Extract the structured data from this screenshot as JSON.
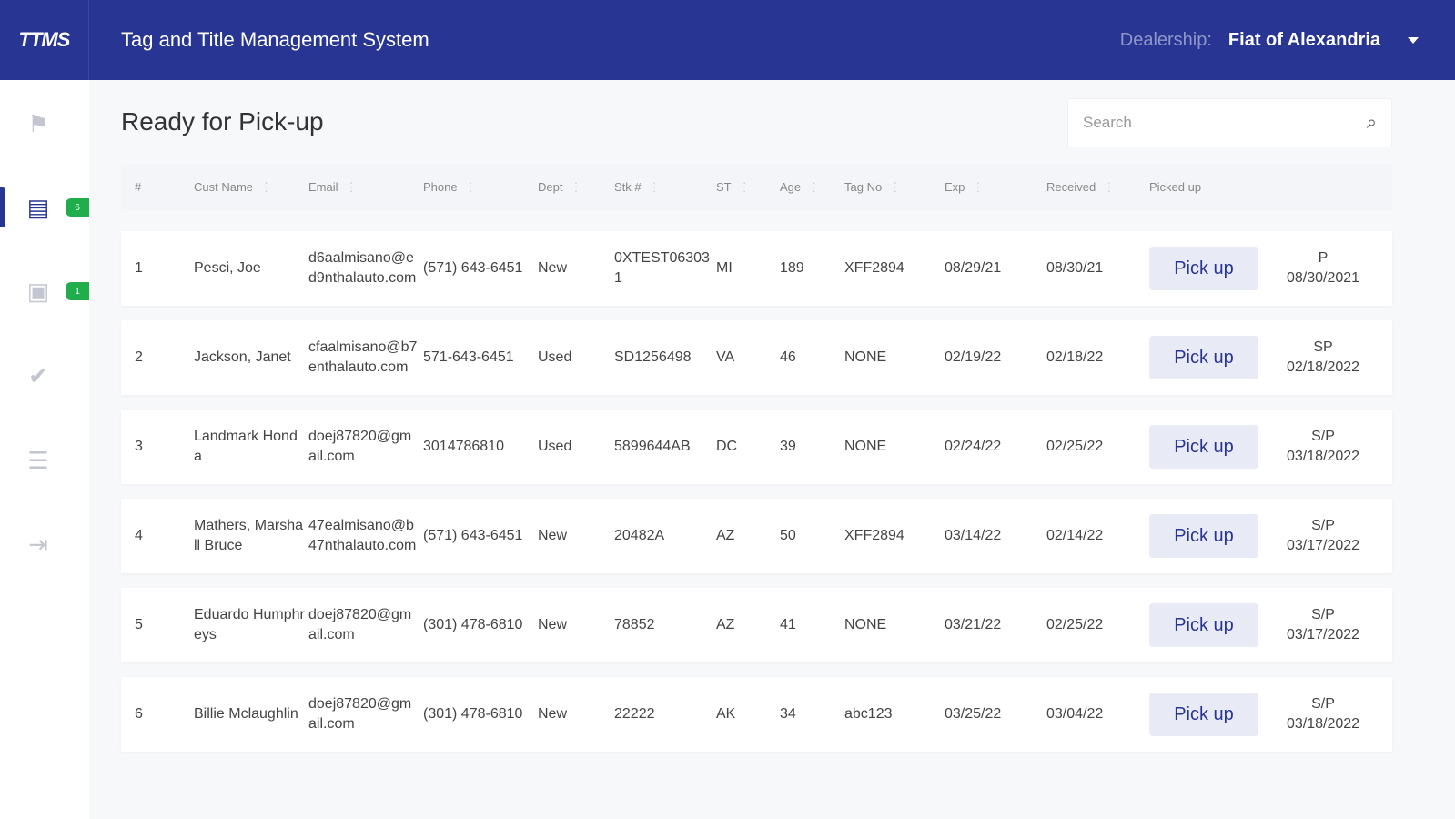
{
  "header": {
    "logo": "TTMS",
    "title": "Tag and Title Management System",
    "dealership_label": "Dealership:",
    "dealership_value": "Fiat of Alexandria"
  },
  "sidebar": {
    "items": [
      {
        "icon": "flag-icon"
      },
      {
        "icon": "book-icon",
        "badge": "6",
        "active": true
      },
      {
        "icon": "inbox-icon",
        "badge": "1"
      },
      {
        "icon": "check-circle-icon"
      },
      {
        "icon": "list-icon"
      },
      {
        "icon": "logout-icon"
      }
    ]
  },
  "page": {
    "title": "Ready for Pick-up",
    "search_placeholder": "Search"
  },
  "table": {
    "columns": [
      "#",
      "Cust Name",
      "Email",
      "Phone",
      "Dept",
      "Stk #",
      "ST",
      "Age",
      "Tag No",
      "Exp",
      "Received",
      "Picked up"
    ],
    "button_label": "Pick up",
    "rows": [
      {
        "n": "1",
        "name": "Pesci, Joe",
        "email": "d6aalmisano@ed9nthalauto.com",
        "phone": "(571) 643-6451",
        "dept": "New",
        "stk": "0XTEST063031",
        "st": "MI",
        "age": "189",
        "tag": "XFF2894",
        "exp": "08/29/21",
        "received": "08/30/21",
        "picked_code": "P",
        "picked_date": "08/30/2021"
      },
      {
        "n": "2",
        "name": "Jackson, Janet",
        "email": "cfaalmisano@b7enthalauto.com",
        "phone": "571-643-6451",
        "dept": "Used",
        "stk": "SD1256498",
        "st": "VA",
        "age": "46",
        "tag": "NONE",
        "exp": "02/19/22",
        "received": "02/18/22",
        "picked_code": "SP",
        "picked_date": "02/18/2022"
      },
      {
        "n": "3",
        "name": "Landmark Honda",
        "email": "doej87820@gmail.com",
        "phone": "3014786810",
        "dept": "Used",
        "stk": "5899644AB",
        "st": "DC",
        "age": "39",
        "tag": "NONE",
        "exp": "02/24/22",
        "received": "02/25/22",
        "picked_code": "S/P",
        "picked_date": "03/18/2022"
      },
      {
        "n": "4",
        "name": "Mathers, Marshall Bruce",
        "email": "47ealmisano@b47nthalauto.com",
        "phone": "(571) 643-6451",
        "dept": "New",
        "stk": "20482A",
        "st": "AZ",
        "age": "50",
        "tag": "XFF2894",
        "exp": "03/14/22",
        "received": "02/14/22",
        "picked_code": "S/P",
        "picked_date": "03/17/2022"
      },
      {
        "n": "5",
        "name": "Eduardo Humphreys",
        "email": "doej87820@gmail.com",
        "phone": "(301) 478-6810",
        "dept": "New",
        "stk": "78852",
        "st": "AZ",
        "age": "41",
        "tag": "NONE",
        "exp": "03/21/22",
        "received": "02/25/22",
        "picked_code": "S/P",
        "picked_date": "03/17/2022"
      },
      {
        "n": "6",
        "name": "Billie Mclaughlin",
        "email": "doej87820@gmail.com",
        "phone": "(301) 478-6810",
        "dept": "New",
        "stk": "22222",
        "st": "AK",
        "age": "34",
        "tag": "abc123",
        "exp": "03/25/22",
        "received": "03/04/22",
        "picked_code": "S/P",
        "picked_date": "03/18/2022"
      }
    ]
  }
}
